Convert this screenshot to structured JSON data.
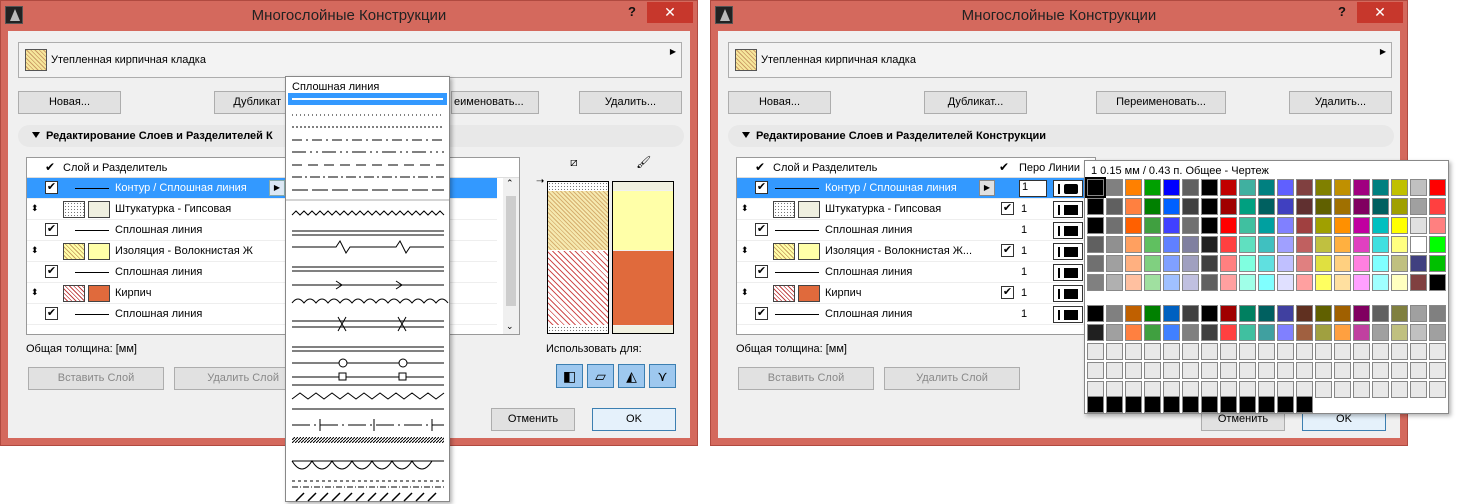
{
  "title": "Многослойные Конструкции",
  "help": "?",
  "close": "✕",
  "composite_name": "Утепленная кирпичная кладка",
  "buttons": {
    "new": "Новая...",
    "duplicate": "Дубликат...",
    "rename": "Переименовать...",
    "delete": "Удалить...",
    "insert_layer": "Вставить Слой",
    "delete_layer": "Удалить Слой",
    "cancel": "Отменить",
    "ok": "OK"
  },
  "buttons_left_partial": {
    "duplicate": "Дубликат",
    "rename": "еименовать..."
  },
  "section": "Редактирование Слоев и Разделителей Конструкции",
  "section_left": "Редактирование Слоев и Разделителей К",
  "columns": {
    "layer": "Слой и Разделитель",
    "pen": "Перо Линии"
  },
  "rows": [
    "Контур / Сплошная линия",
    "Штукатурка - Гипсовая",
    "Сплошная линия",
    "Изоляция - Волокнистая Ж...",
    "Сплошная линия",
    "Кирпич",
    "Сплошная линия"
  ],
  "rows_left": [
    "Контур / Сплошная линия",
    "Штукатурка - Гипсовая",
    "Сплошная линия",
    "Изоляция - Волокнистая Ж",
    "Сплошная линия",
    "Кирпич",
    "Сплошная линия"
  ],
  "pen_values": [
    "1",
    "1",
    "1",
    "1",
    "1",
    "1",
    "1"
  ],
  "total_thickness": "Общая толщина: [мм]",
  "use_for": "Использовать для:",
  "line_popup_title": "Сплошная линия",
  "pen_popup_header": "1  0.15 мм /  0.43 п.  Общее - Чертеж",
  "colors": {
    "plaster": "#f0f0e0",
    "insulation": "#ffffa8",
    "brick": "#e06a3c",
    "select": "#3399ff"
  }
}
